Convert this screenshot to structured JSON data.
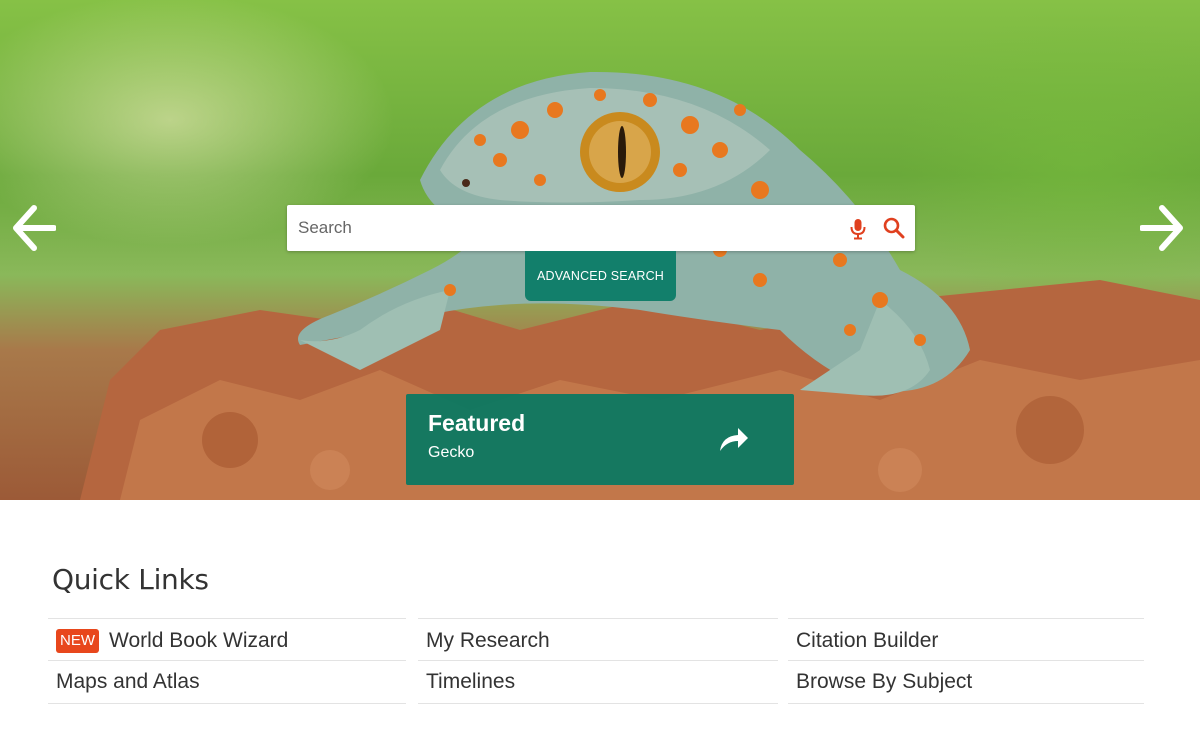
{
  "search": {
    "placeholder": "Search",
    "value": "",
    "advanced_label": "ADVANCED SEARCH"
  },
  "carousel": {
    "prev_icon": "arrow-left-icon",
    "next_icon": "arrow-right-icon"
  },
  "featured": {
    "title": "Featured",
    "subtitle": "Gecko",
    "icon": "share-forward-icon"
  },
  "quick_links": {
    "heading": "Quick Links",
    "badge_new": "NEW",
    "items": [
      {
        "label": "World Book Wizard",
        "is_new": true
      },
      {
        "label": "My Research",
        "is_new": false
      },
      {
        "label": "Citation Builder",
        "is_new": false
      },
      {
        "label": "Maps and Atlas",
        "is_new": false
      },
      {
        "label": "Timelines",
        "is_new": false
      },
      {
        "label": "Browse By Subject",
        "is_new": false
      }
    ]
  },
  "colors": {
    "accent_teal": "#127f6b",
    "badge_red": "#e8471c",
    "icon_red": "#e0401f"
  }
}
